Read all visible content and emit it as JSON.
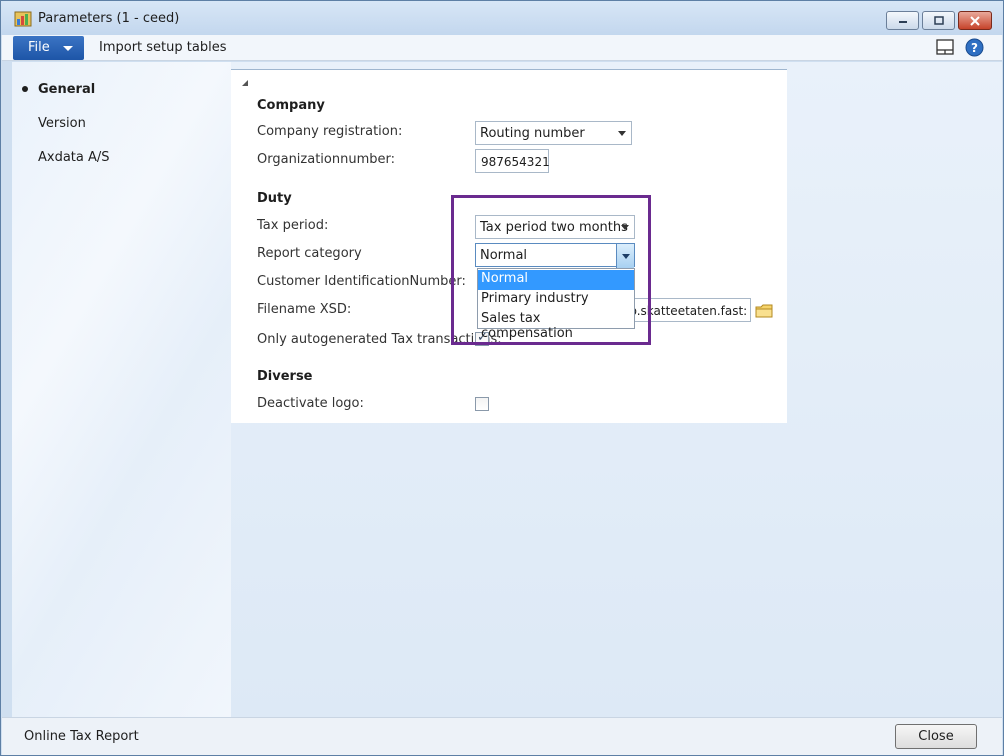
{
  "window": {
    "title": "Parameters (1 - ceed)"
  },
  "menu": {
    "file_label": "File",
    "import_label": "Import setup tables"
  },
  "nav": {
    "items": [
      {
        "label": "General"
      },
      {
        "label": "Version"
      },
      {
        "label": "Axdata A/S"
      }
    ]
  },
  "form": {
    "company_heading": "Company",
    "company_registration_label": "Company registration:",
    "company_registration_value": "Routing number",
    "org_number_label": "Organizationnumber:",
    "org_number_value": "987654321",
    "duty_heading": "Duty",
    "tax_period_label": "Tax period:",
    "tax_period_value": "Tax period two months",
    "report_category_label": "Report category",
    "report_category_value": "Normal",
    "report_category_options": [
      "Normal",
      "Primary industry",
      "Sales tax compensation"
    ],
    "customer_id_label": "Customer IdentificationNumber:",
    "filename_xsd_label": "Filename XSD:",
    "filename_xsd_value": "no.skatteetaten.fast:",
    "only_autogen_label": "Only autogenerated Tax transactions:",
    "only_autogen_checked": true,
    "diverse_heading": "Diverse",
    "deactivate_logo_label": "Deactivate logo:",
    "deactivate_logo_checked": false
  },
  "status": {
    "text": "Online Tax Report",
    "close_label": "Close"
  },
  "icons": [
    "app-icon",
    "minimize-icon",
    "maximize-icon",
    "close-icon",
    "layout-icon",
    "help-icon",
    "folder-icon",
    "collapse-icon"
  ],
  "colors": {
    "accent": "#1d55a7",
    "selection": "#3399ff",
    "highlight_box": "#6a2a8f"
  }
}
